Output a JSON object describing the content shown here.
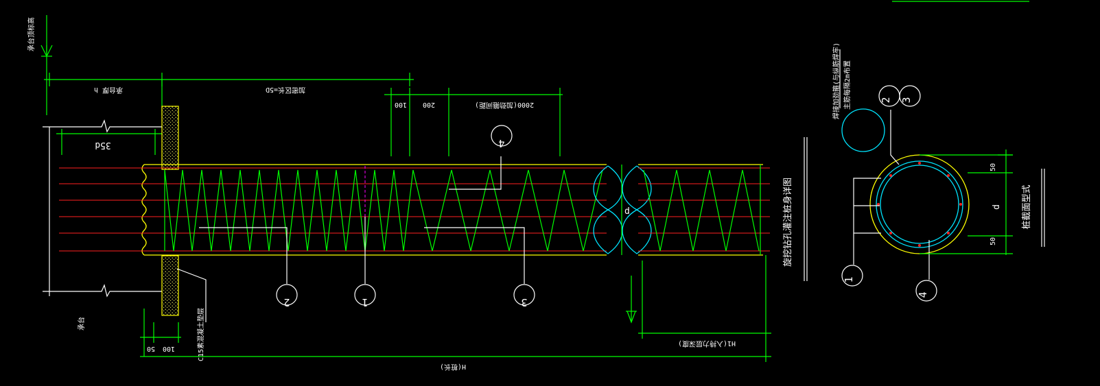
{
  "colors": {
    "background": "#000000",
    "dimension_green": "#00ff00",
    "outline_yellow": "#ffff00",
    "rebar_red": "#ff2020",
    "spiral_green": "#00ff00",
    "leader_white": "#ffffff",
    "circle_cyan": "#00e5ff"
  },
  "elevation": {
    "label": "承台顶标高"
  },
  "dims": {
    "h_label": "承台厚 h",
    "spiral_5d_label": "加密区长=5D",
    "d35_label": "35d",
    "d100": "100",
    "d200": "200",
    "d2000_label": "2000(加劲箍间距)",
    "d50": "50",
    "d100_bottom": "100",
    "h1_label": "H1(入持力层深度)",
    "h_total_label": "H(桩长)",
    "d_label": "d",
    "d_section_label": "d",
    "d50_top": "50",
    "d50_bottom": "50"
  },
  "labels": {
    "cap": "承台",
    "c15": "C15素混凝土垫层",
    "pile_detail_title": "旋挖钻孔灌注桩身详图",
    "section_title": "桩截面型式",
    "stiffener_note_1": "焊接加劲箍(与纵筋焊牢)",
    "stiffener_note_2": "主筋每隔2m布置"
  },
  "callouts": {
    "n1": "1",
    "n2": "2",
    "n3": "3",
    "n4": "4",
    "s1": "1",
    "s2": "2",
    "s3": "3",
    "s4": "4"
  }
}
